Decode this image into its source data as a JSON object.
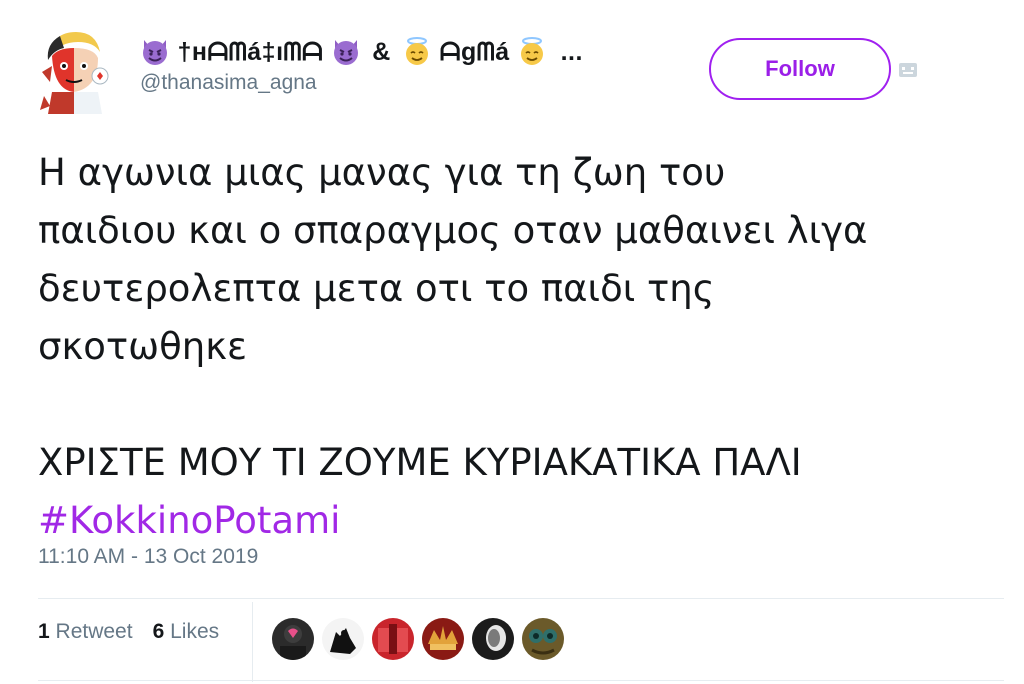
{
  "tweet": {
    "display_name": "†нᗩᗰá‡ıᗰᗩ",
    "display_name_amp": "&",
    "display_name_2": "ᗩgᗰá",
    "display_name_ellipsis": "...",
    "handle": "@thanasima_agna",
    "follow_label": "Follow",
    "lines": [
      "Η αγωνια μιας μανας για τη ζωη του",
      "παιδιου και ο σπαραγμος οταν μαθαινει λιγα",
      "δευτερολεπτα μετα οτι το παιδι της",
      "σκοτωθηκε",
      "ΧΡΙΣΤΕ ΜΟΥ ΤΙ ΖΟΥΜΕ ΚΥΡΙΑΚΑΤΙΚΑ ΠΑΛΙ"
    ],
    "hashtag": "#KokkinoPotami",
    "timestamp": "11:10 AM - 13 Oct 2019",
    "retweet_count": "1",
    "retweet_label": "Retweet",
    "likes_count": "6",
    "likes_label": "Likes",
    "icons": [
      "devil-emoji-icon",
      "angel-emoji-icon",
      "more-menu-icon"
    ],
    "colors": {
      "accent": "#a020f0",
      "hashtag": "#a128e6",
      "muted": "#657786"
    },
    "liker_count": 6
  }
}
